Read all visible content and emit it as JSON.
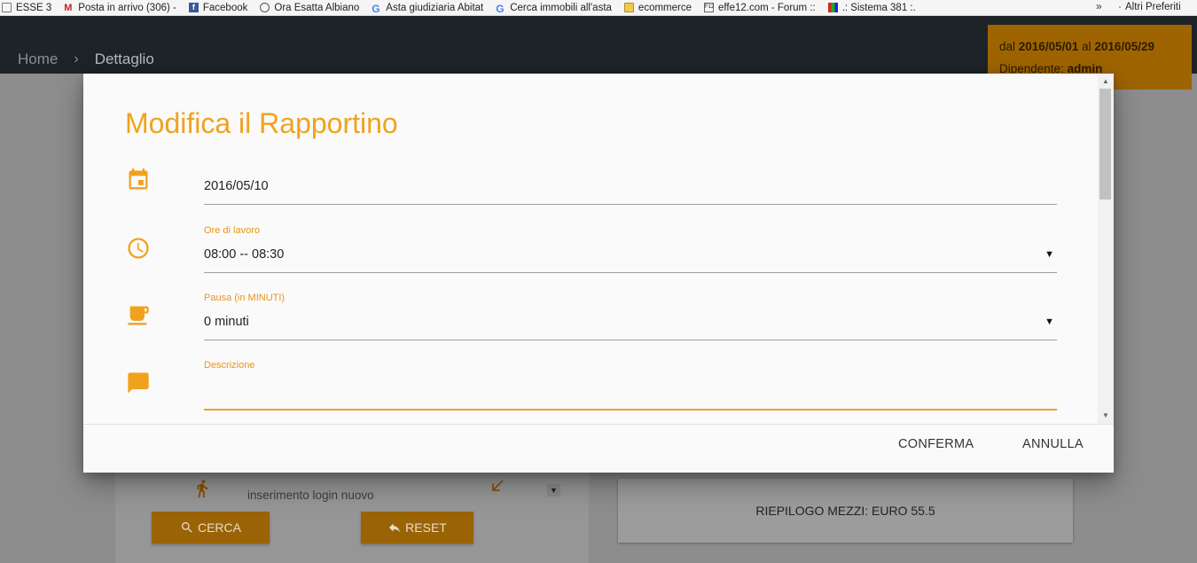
{
  "bookmarks": [
    {
      "label": "ESSE 3",
      "icon": "page-icon"
    },
    {
      "label": "Posta in arrivo (306) -",
      "icon": "gmail-icon"
    },
    {
      "label": "Facebook",
      "icon": "facebook-icon"
    },
    {
      "label": "Ora Esatta Albiano",
      "icon": "clock-circle-icon"
    },
    {
      "label": "Asta giudiziaria Abitat",
      "icon": "google-icon"
    },
    {
      "label": "Cerca immobili all'asta",
      "icon": "google-icon"
    },
    {
      "label": "ecommerce",
      "icon": "folder-icon"
    },
    {
      "label": "effe12.com - Forum ::",
      "icon": "f12-icon"
    },
    {
      "label": ".: Sistema 381 :.",
      "icon": "grid-icon"
    }
  ],
  "bookmarks_more": "»",
  "bookmarks_other": "Altri Preferiti",
  "breadcrumb": {
    "home": "Home",
    "separator": "›",
    "current": "Dettaglio"
  },
  "info": {
    "from_label": "dal",
    "from_date": "2016/05/01",
    "to_label": "al",
    "to_date": "2016/05/29",
    "employee_label": "Dipendente:",
    "employee": "admin"
  },
  "background": {
    "login_text": "inserimento login nuovo",
    "search_button": "CERCA",
    "reset_button": "RESET",
    "summary": "RIEPILOGO MEZZI: EURO 55.5"
  },
  "dialog": {
    "title": "Modifica il Rapportino",
    "date_value": "2016/05/10",
    "hours_label": "Ore di lavoro",
    "hours_value": "08:00 -- 08:30",
    "pause_label": "Pausa (in MINUTI)",
    "pause_value": "0 minuti",
    "description_label": "Descrizione",
    "description_value": "",
    "caret": "▼",
    "confirm": "CONFERMA",
    "cancel": "ANNULLA"
  },
  "colors": {
    "accent": "#f0a21e",
    "header": "#1d2327",
    "dialog_bg": "#fafafa"
  }
}
